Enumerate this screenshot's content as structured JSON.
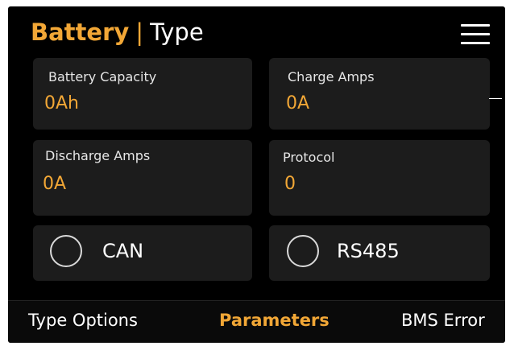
{
  "header": {
    "title_main": "Battery",
    "separator": "|",
    "title_sub": "Type",
    "menu_icon": "hamburger-menu-icon"
  },
  "fields": {
    "battery_capacity": {
      "label": "Battery Capacity",
      "value": "0Ah"
    },
    "charge_amps": {
      "label": "Charge Amps",
      "value": "0A"
    },
    "discharge_amps": {
      "label": "Discharge Amps",
      "value": "0A"
    },
    "protocol": {
      "label": "Protocol",
      "value": "0"
    }
  },
  "protocol_options": [
    {
      "label": "CAN",
      "selected": false
    },
    {
      "label": "RS485",
      "selected": false
    }
  ],
  "tabs": [
    {
      "label": "Type Options",
      "active": false
    },
    {
      "label": "Parameters",
      "active": true
    },
    {
      "label": "BMS Error",
      "active": false
    }
  ],
  "colors": {
    "accent": "#f2a736",
    "background": "#000000",
    "card": "#1c1c1c",
    "text": "#ffffff"
  }
}
